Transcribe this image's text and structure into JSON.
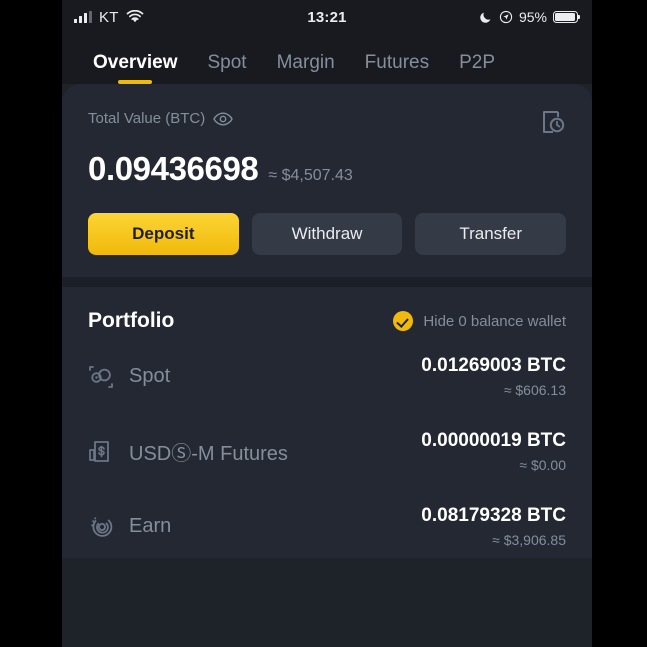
{
  "statusbar": {
    "carrier": "KT",
    "time": "13:21",
    "battery_percent": "95%",
    "signal_icon": "signal-bars-icon",
    "wifi_icon": "wifi-icon",
    "moon_icon": "do-not-disturb-moon-icon",
    "location_icon": "location-services-icon",
    "battery_icon": "battery-icon"
  },
  "tabs": [
    {
      "label": "Overview",
      "active": true
    },
    {
      "label": "Spot",
      "active": false
    },
    {
      "label": "Margin",
      "active": false
    },
    {
      "label": "Futures",
      "active": false
    },
    {
      "label": "P2P",
      "active": false
    }
  ],
  "balance_card": {
    "label": "Total Value (BTC)",
    "eye_icon": "eye-visible-icon",
    "history_icon": "transaction-history-icon",
    "value": "0.09436698",
    "approx_value": "≈ $4,507.43",
    "buttons": [
      {
        "label": "Deposit",
        "style": "primary"
      },
      {
        "label": "Withdraw",
        "style": "secondary"
      },
      {
        "label": "Transfer",
        "style": "secondary"
      }
    ]
  },
  "portfolio": {
    "title": "Portfolio",
    "hide_toggle_label": "Hide 0 balance wallet",
    "hide_toggle_checked": true,
    "rows": [
      {
        "icon": "spot-wallet-icon",
        "label": "Spot",
        "amount": "0.01269003 BTC",
        "usd": "≈ $606.13"
      },
      {
        "icon": "usd-m-futures-icon",
        "label": "USDⓈ-M Futures",
        "amount": "0.00000019 BTC",
        "usd": "≈ $0.00"
      },
      {
        "icon": "earn-icon",
        "label": "Earn",
        "amount": "0.08179328 BTC",
        "usd": "≈ $3,906.85"
      }
    ]
  },
  "colors": {
    "accent_yellow": "#f0b90b",
    "accent_yellow_light": "#fcd535",
    "background": "#1e2329",
    "card_background": "#242832",
    "statusbar_background": "#181a20",
    "text_primary": "#ffffff",
    "text_secondary": "#848e9c",
    "letterbox": "#000000"
  }
}
